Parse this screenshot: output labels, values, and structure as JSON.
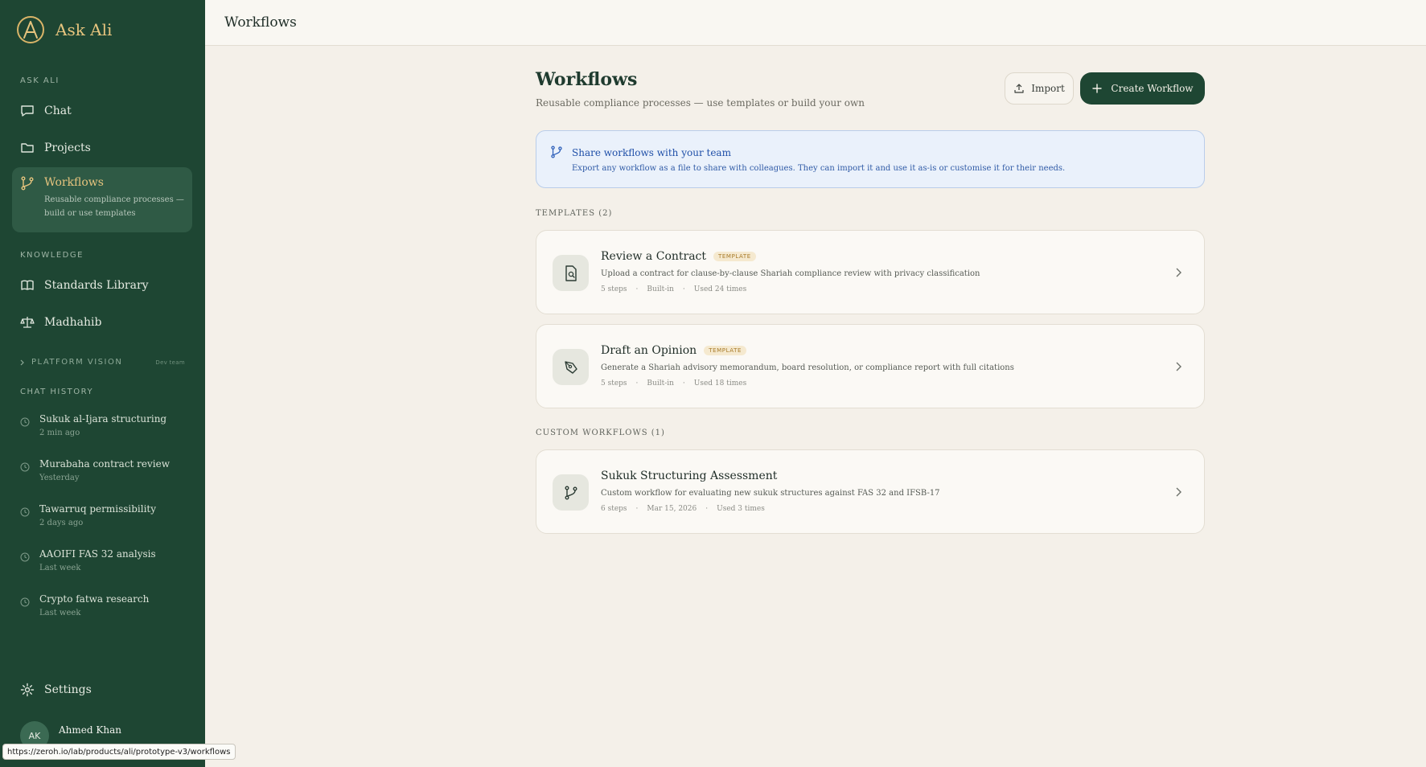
{
  "brand": {
    "name": "Ask Ali"
  },
  "sidebar": {
    "section_ask": "ASK ALI",
    "nav": [
      {
        "label": "Chat",
        "icon": "chat-bubble-icon"
      },
      {
        "label": "Projects",
        "icon": "folder-icon"
      },
      {
        "label": "Workflows",
        "icon": "workflow-icon",
        "description": "Reusable compliance processes — build or use templates",
        "active": true
      }
    ],
    "section_knowledge": "KNOWLEDGE",
    "knowledge": [
      {
        "label": "Standards Library",
        "icon": "book-icon"
      },
      {
        "label": "Madhahib",
        "icon": "scales-icon"
      }
    ],
    "platform_vision": {
      "label": "PLATFORM VISION",
      "badge": "Dev team"
    },
    "section_history": "CHAT HISTORY",
    "history": [
      {
        "title": "Sukuk al-Ijara structuring",
        "time": "2 min ago"
      },
      {
        "title": "Murabaha contract review",
        "time": "Yesterday"
      },
      {
        "title": "Tawarruq permissibility",
        "time": "2 days ago"
      },
      {
        "title": "AAOIFI FAS 32 analysis",
        "time": "Last week"
      },
      {
        "title": "Crypto fatwa research",
        "time": "Last week"
      }
    ],
    "settings_label": "Settings",
    "user": {
      "initials": "AK",
      "name": "Ahmed Khan"
    }
  },
  "status_url": "https://zeroh.io/lab/products/ali/prototype-v3/workflows",
  "topbar": {
    "title": "Workflows"
  },
  "main": {
    "title": "Workflows",
    "subtitle": "Reusable compliance processes — use templates or build your own",
    "import_label": "Import",
    "create_label": "Create Workflow",
    "banner": {
      "title": "Share workflows with your team",
      "text": "Export any workflow as a file to share with colleagues. They can import it and use it as-is or customise it for their needs."
    },
    "templates_label": "TEMPLATES (2)",
    "templates": [
      {
        "title": "Review a Contract",
        "badge": "TEMPLATE",
        "desc": "Upload a contract for clause-by-clause Shariah compliance review with privacy classification",
        "steps": "5 steps",
        "source": "Built-in",
        "used": "Used 24 times",
        "icon": "document-search-icon"
      },
      {
        "title": "Draft an Opinion",
        "badge": "TEMPLATE",
        "desc": "Generate a Shariah advisory memorandum, board resolution, or compliance report with full citations",
        "steps": "5 steps",
        "source": "Built-in",
        "used": "Used 18 times",
        "icon": "pen-nib-icon"
      }
    ],
    "custom_label": "CUSTOM WORKFLOWS (1)",
    "custom": [
      {
        "title": "Sukuk Structuring Assessment",
        "desc": "Custom workflow for evaluating new sukuk structures against FAS 32 and IFSB-17",
        "steps": "6 steps",
        "date": "Mar 15, 2026",
        "used": "Used 3 times",
        "icon": "workflow-icon"
      }
    ],
    "meta_separator": "·"
  },
  "colors": {
    "sidebar": "#1e4633",
    "accent_gold": "#e6c47e",
    "primary": "#1e4633",
    "banner_bg": "#eaf1fb",
    "banner_text": "#1f4fa8",
    "page_bg": "#f4f0e9"
  }
}
